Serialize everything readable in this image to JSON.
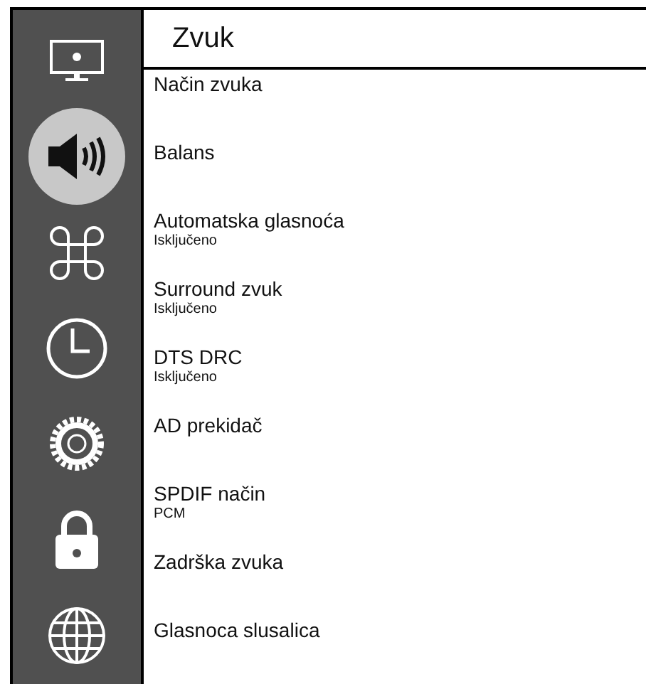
{
  "sidebar": {
    "items": [
      {
        "selected": false
      },
      {
        "selected": true
      },
      {
        "selected": false
      },
      {
        "selected": false
      },
      {
        "selected": false
      },
      {
        "selected": false
      },
      {
        "selected": false
      }
    ]
  },
  "header": {
    "title": "Zvuk"
  },
  "menu": {
    "items": [
      {
        "label": "Način zvuka"
      },
      {
        "label": "Balans"
      },
      {
        "label": "Automatska glasnoća",
        "value": "Isključeno"
      },
      {
        "label": "Surround zvuk",
        "value": "Isključeno"
      },
      {
        "label": "DTS DRC",
        "value": "Isključeno"
      },
      {
        "label": "AD prekidač"
      },
      {
        "label": "SPDIF način",
        "value": "PCM"
      },
      {
        "label": "Zadrška zvuka"
      },
      {
        "label": "Glasnoca slusalica"
      }
    ]
  }
}
